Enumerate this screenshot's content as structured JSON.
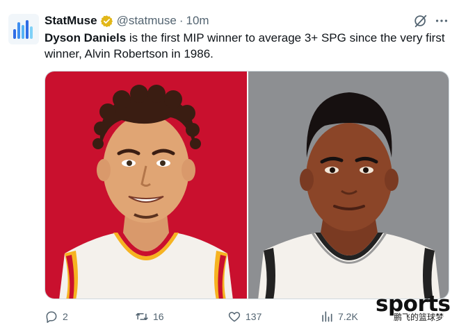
{
  "tweet": {
    "display_name": "StatMuse",
    "handle": "@statmuse",
    "separator": "·",
    "time": "10m",
    "text_bold": "Dyson Daniels",
    "text_rest": " is the first MIP winner to average 3+ SPG since the very first winner, Alvin Robertson in 1986."
  },
  "media": {
    "left_bg": "#c9102e",
    "right_bg": "#8d8f92"
  },
  "actions": {
    "replies": "2",
    "reposts": "16",
    "likes": "137",
    "views": "7.2K"
  },
  "watermark": {
    "brand": "sports",
    "sub": "鹏飞的篮球梦"
  },
  "icons": [
    "verified-badge-icon",
    "grok-icon",
    "more-icon",
    "reply-icon",
    "repost-icon",
    "like-icon",
    "views-icon"
  ],
  "colors": {
    "accent_blue": "#1d9bf0",
    "gold_badge": "#e2b719",
    "muted": "#536471"
  }
}
